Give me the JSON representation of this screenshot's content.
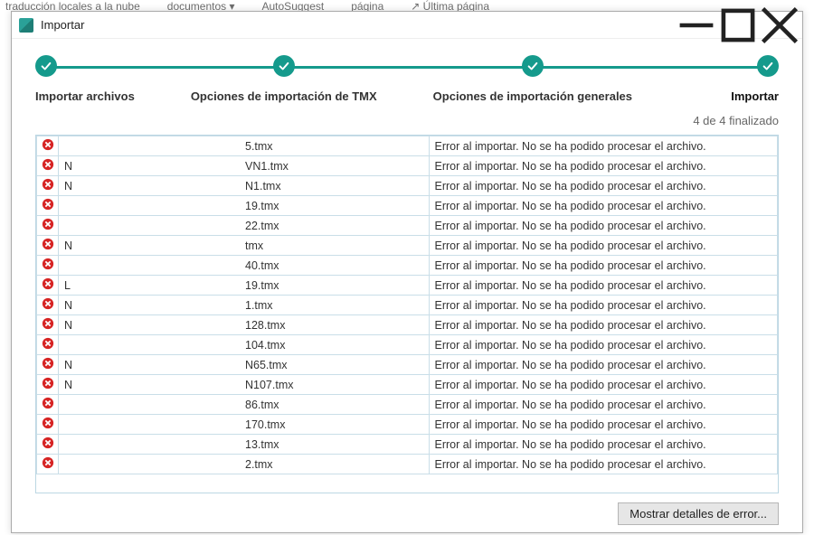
{
  "bg_menu": {
    "item1": "traducción locales a la nube",
    "item2": "documentos ▾",
    "item3": "AutoSuggest",
    "item4": "página",
    "item5": "↗ Última página"
  },
  "window": {
    "title": "Importar"
  },
  "wizard": {
    "steps": [
      {
        "label": "Importar archivos"
      },
      {
        "label": "Opciones de importación de TMX"
      },
      {
        "label": "Opciones de importación generales"
      },
      {
        "label": "Importar"
      }
    ],
    "active_index": 3
  },
  "summary": "4 de 4 finalizado",
  "error_message": "Error al importar. No se ha podido procesar el archivo.",
  "files": [
    {
      "prefix": "",
      "suffix": "5.tmx"
    },
    {
      "prefix": "N",
      "suffix": "VN1.tmx"
    },
    {
      "prefix": "N",
      "suffix": "N1.tmx"
    },
    {
      "prefix": "",
      "suffix": "19.tmx"
    },
    {
      "prefix": "",
      "suffix": "22.tmx"
    },
    {
      "prefix": "N",
      "suffix": "tmx"
    },
    {
      "prefix": "",
      "suffix": "40.tmx"
    },
    {
      "prefix": "L",
      "suffix": "19.tmx"
    },
    {
      "prefix": "N",
      "suffix": "1.tmx"
    },
    {
      "prefix": "N",
      "suffix": "128.tmx"
    },
    {
      "prefix": "",
      "suffix": "  104.tmx"
    },
    {
      "prefix": "N",
      "suffix": "N65.tmx"
    },
    {
      "prefix": "N",
      "suffix": "N107.tmx"
    },
    {
      "prefix": "",
      "suffix": "86.tmx"
    },
    {
      "prefix": "",
      "suffix": "170.tmx"
    },
    {
      "prefix": "",
      "suffix": "13.tmx"
    },
    {
      "prefix": "",
      "suffix": "2.tmx"
    }
  ],
  "footer": {
    "details_button": "Mostrar detalles de error..."
  }
}
